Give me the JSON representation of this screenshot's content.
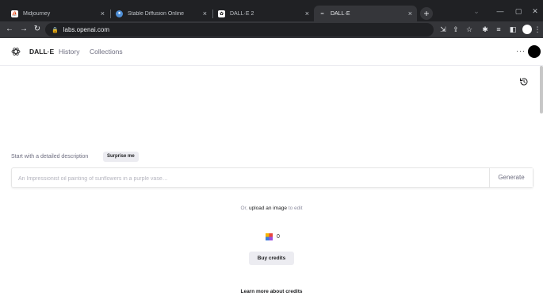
{
  "browser": {
    "tabs": [
      {
        "title": "Midjourney",
        "favicon": "midjourney-favicon",
        "active": false
      },
      {
        "title": "Stable Diffusion Online",
        "favicon": "stable-diffusion-favicon",
        "active": false
      },
      {
        "title": "DALL·E 2",
        "favicon": "openai-favicon",
        "active": false
      },
      {
        "title": "DALL·E",
        "favicon": "dash-favicon",
        "active": true
      }
    ],
    "new_tab_label": "+",
    "close_glyph": "×",
    "url": "labs.openai.com",
    "colors": {
      "tabbar": "#202124",
      "toolbar": "#35363a",
      "omnibox": "#202124"
    }
  },
  "app": {
    "brand": "DALL·E",
    "nav": {
      "history": "History",
      "collections": "Collections"
    },
    "more_label": "···",
    "colors": {
      "text": "#202123",
      "muted": "#6e6e80",
      "button_bg": "#ececf1"
    }
  },
  "main": {
    "start_label": "Start with a detailed description",
    "surprise_label": "Surprise me",
    "prompt_placeholder": "An Impressionist oil painting of sunflowers in a purple vase…",
    "prompt_value": "",
    "generate_label": "Generate",
    "or_text": "Or,",
    "upload_text": "upload an image",
    "to_edit_text": "to edit",
    "credits_count": "0",
    "buy_credits_label": "Buy credits",
    "learn_more_label": "Learn more about credits"
  }
}
